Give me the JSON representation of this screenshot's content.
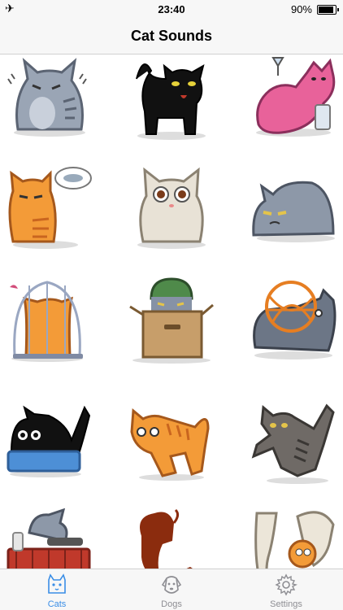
{
  "status_bar": {
    "time": "23:40",
    "battery": "90%",
    "airplane_glyph": "✈"
  },
  "nav": {
    "title": "Cat Sounds"
  },
  "grid": {
    "items": [
      {
        "name": "grey-cat-shivering"
      },
      {
        "name": "black-cat-hissing"
      },
      {
        "name": "pink-cat-drinking"
      },
      {
        "name": "orange-cat-dreaming-fish"
      },
      {
        "name": "white-cat-surprised"
      },
      {
        "name": "grey-cat-grumpy-lying"
      },
      {
        "name": "orange-cat-in-cage"
      },
      {
        "name": "cat-in-box-with-helmet"
      },
      {
        "name": "grey-cat-yarn-ball"
      },
      {
        "name": "black-cat-litter-box"
      },
      {
        "name": "orange-cat-jumping"
      },
      {
        "name": "grey-tabby-cat-leaping"
      },
      {
        "name": "cat-shopping-basket"
      },
      {
        "name": "lion-silhouette"
      },
      {
        "name": "cat-with-vacuum"
      }
    ]
  },
  "tabs": [
    {
      "label": "Cats",
      "icon": "cat-icon",
      "active": true
    },
    {
      "label": "Dogs",
      "icon": "dog-icon",
      "active": false
    },
    {
      "label": "Settings",
      "icon": "gear-icon",
      "active": false
    }
  ],
  "colors": {
    "accent": "#3a8ee6",
    "inactive": "#8e8e93"
  }
}
